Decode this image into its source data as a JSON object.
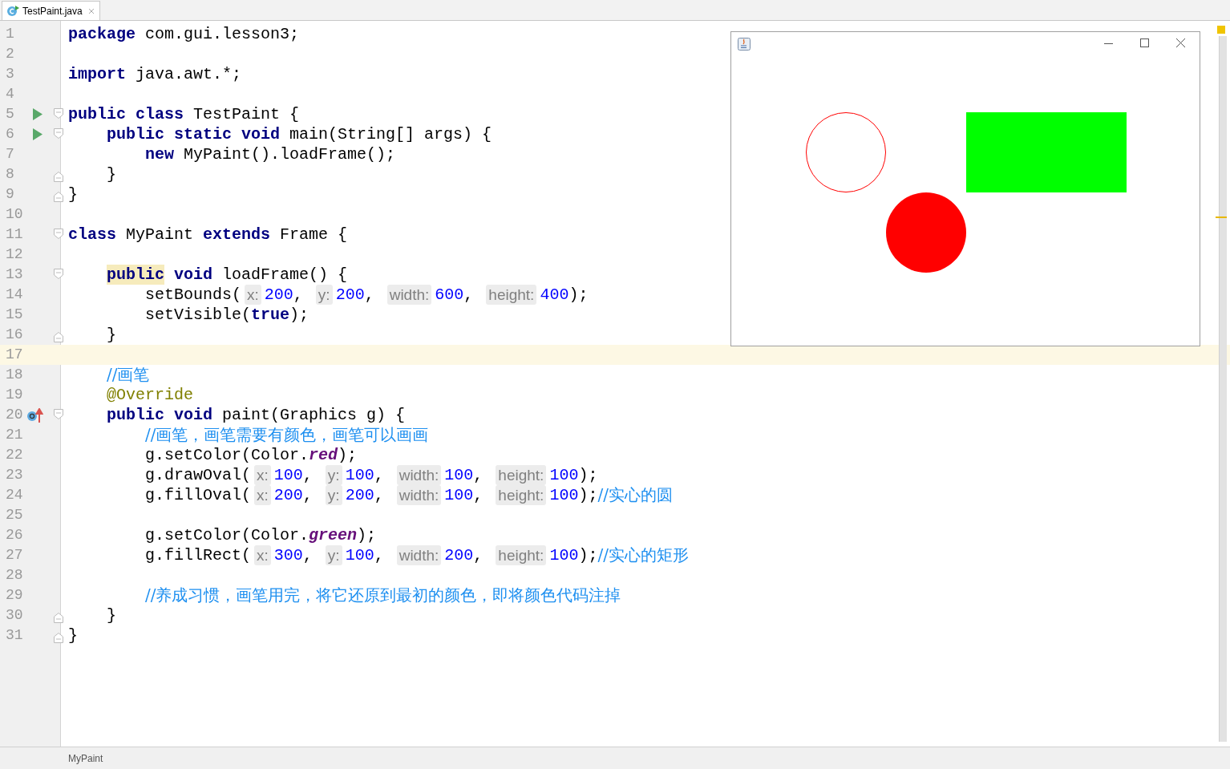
{
  "tabs": [
    {
      "label": "TestPaint.java",
      "selected": true
    }
  ],
  "editor": {
    "lines": [
      {
        "number": "1",
        "current": false,
        "run": false,
        "override": false,
        "fold_start": false,
        "fold_end": false,
        "tokens": [
          {
            "kind": "keyword",
            "text": "package"
          },
          {
            "kind": "plain",
            "text": " com.gui.lesson3;"
          }
        ]
      },
      {
        "number": "2",
        "current": false,
        "run": false,
        "override": false,
        "fold_start": false,
        "fold_end": false
      },
      {
        "number": "3",
        "current": false,
        "run": false,
        "override": false,
        "fold_start": false,
        "fold_end": false,
        "tokens": [
          {
            "kind": "keyword",
            "text": "import"
          },
          {
            "kind": "plain",
            "text": " java.awt.*;"
          }
        ]
      },
      {
        "number": "4",
        "current": false,
        "run": false,
        "override": false,
        "fold_start": false,
        "fold_end": false
      },
      {
        "number": "5",
        "current": false,
        "run": true,
        "override": false,
        "fold_start": true,
        "fold_end": false,
        "tokens": [
          {
            "kind": "keyword",
            "text": "public class"
          },
          {
            "kind": "plain",
            "text": " TestPaint {"
          }
        ]
      },
      {
        "number": "6",
        "current": false,
        "run": true,
        "override": false,
        "fold_start": true,
        "fold_end": false,
        "tokens": [
          {
            "kind": "keyword",
            "text": "    public static void"
          },
          {
            "kind": "plain",
            "text": " main(String[] args) {"
          }
        ]
      },
      {
        "number": "7",
        "current": false,
        "run": false,
        "override": false,
        "fold_start": false,
        "fold_end": false,
        "tokens": [
          {
            "kind": "keyword",
            "text": "        new"
          },
          {
            "kind": "plain",
            "text": " MyPaint().loadFrame();"
          }
        ]
      },
      {
        "number": "8",
        "current": false,
        "run": false,
        "override": false,
        "fold_start": false,
        "fold_end": true,
        "tokens": [
          {
            "kind": "plain",
            "text": "    }"
          }
        ]
      },
      {
        "number": "9",
        "current": false,
        "run": false,
        "override": false,
        "fold_start": false,
        "fold_end": true,
        "tokens": [
          {
            "kind": "plain",
            "text": "}"
          }
        ]
      },
      {
        "number": "10",
        "current": false,
        "run": false,
        "override": false,
        "fold_start": false,
        "fold_end": false
      },
      {
        "number": "11",
        "current": false,
        "run": false,
        "override": false,
        "fold_start": true,
        "fold_end": false,
        "tokens": [
          {
            "kind": "keyword",
            "text": "class"
          },
          {
            "kind": "plain",
            "text": " MyPaint "
          },
          {
            "kind": "keyword",
            "text": "extends"
          },
          {
            "kind": "plain",
            "text": " Frame {"
          }
        ]
      },
      {
        "number": "12",
        "current": false,
        "run": false,
        "override": false,
        "fold_start": false,
        "fold_end": false
      },
      {
        "number": "13",
        "current": false,
        "run": false,
        "override": false,
        "fold_start": true,
        "fold_end": false,
        "tokens": [
          {
            "kind": "keyword-marked",
            "text": "    public"
          },
          {
            "kind": "keyword",
            "text": " void"
          },
          {
            "kind": "plain",
            "text": " loadFrame() {"
          }
        ]
      },
      {
        "number": "14",
        "current": false,
        "run": false,
        "override": false,
        "fold_start": false,
        "fold_end": false,
        "tokens": [
          {
            "kind": "plain",
            "text": "        setBounds("
          },
          {
            "kind": "hint",
            "text": "x:"
          },
          {
            "kind": "number",
            "text": "200"
          },
          {
            "kind": "plain",
            "text": ", "
          },
          {
            "kind": "hint",
            "text": "y:"
          },
          {
            "kind": "number",
            "text": "200"
          },
          {
            "kind": "plain",
            "text": ", "
          },
          {
            "kind": "hint",
            "text": "width:"
          },
          {
            "kind": "number",
            "text": "600"
          },
          {
            "kind": "plain",
            "text": ", "
          },
          {
            "kind": "hint",
            "text": "height:"
          },
          {
            "kind": "number",
            "text": "400"
          },
          {
            "kind": "plain",
            "text": ");"
          }
        ]
      },
      {
        "number": "15",
        "current": false,
        "run": false,
        "override": false,
        "fold_start": false,
        "fold_end": false,
        "tokens": [
          {
            "kind": "plain",
            "text": "        setVisible("
          },
          {
            "kind": "keyword",
            "text": "true"
          },
          {
            "kind": "plain",
            "text": ");"
          }
        ]
      },
      {
        "number": "16",
        "current": false,
        "run": false,
        "override": false,
        "fold_start": false,
        "fold_end": true,
        "tokens": [
          {
            "kind": "plain",
            "text": "    }"
          }
        ]
      },
      {
        "number": "17",
        "current": true,
        "run": false,
        "override": false,
        "fold_start": false,
        "fold_end": false
      },
      {
        "number": "18",
        "current": false,
        "run": false,
        "override": false,
        "fold_start": false,
        "fold_end": false,
        "tokens": [
          {
            "kind": "comment",
            "text": "    //画笔"
          }
        ]
      },
      {
        "number": "19",
        "current": false,
        "run": false,
        "override": false,
        "fold_start": false,
        "fold_end": false,
        "tokens": [
          {
            "kind": "annotation",
            "text": "    @Override"
          }
        ]
      },
      {
        "number": "20",
        "current": false,
        "run": false,
        "override": true,
        "fold_start": true,
        "fold_end": false,
        "tokens": [
          {
            "kind": "keyword",
            "text": "    public void"
          },
          {
            "kind": "plain",
            "text": " paint(Graphics g) {"
          }
        ]
      },
      {
        "number": "21",
        "current": false,
        "run": false,
        "override": false,
        "fold_start": false,
        "fold_end": false,
        "tokens": [
          {
            "kind": "comment",
            "text": "        //画笔，画笔需要有颜色，画笔可以画画"
          }
        ]
      },
      {
        "number": "22",
        "current": false,
        "run": false,
        "override": false,
        "fold_start": false,
        "fold_end": false,
        "tokens": [
          {
            "kind": "plain",
            "text": "        g.setColor(Color."
          },
          {
            "kind": "field",
            "text": "red"
          },
          {
            "kind": "plain",
            "text": ");"
          }
        ]
      },
      {
        "number": "23",
        "current": false,
        "run": false,
        "override": false,
        "fold_start": false,
        "fold_end": false,
        "tokens": [
          {
            "kind": "plain",
            "text": "        g.drawOval("
          },
          {
            "kind": "hint",
            "text": "x:"
          },
          {
            "kind": "number",
            "text": "100"
          },
          {
            "kind": "plain",
            "text": ", "
          },
          {
            "kind": "hint",
            "text": "y:"
          },
          {
            "kind": "number",
            "text": "100"
          },
          {
            "kind": "plain",
            "text": ", "
          },
          {
            "kind": "hint",
            "text": "width:"
          },
          {
            "kind": "number",
            "text": "100"
          },
          {
            "kind": "plain",
            "text": ", "
          },
          {
            "kind": "hint",
            "text": "height:"
          },
          {
            "kind": "number",
            "text": "100"
          },
          {
            "kind": "plain",
            "text": ");"
          }
        ]
      },
      {
        "number": "24",
        "current": false,
        "run": false,
        "override": false,
        "fold_start": false,
        "fold_end": false,
        "tokens": [
          {
            "kind": "plain",
            "text": "        g.fillOval("
          },
          {
            "kind": "hint",
            "text": "x:"
          },
          {
            "kind": "number",
            "text": "200"
          },
          {
            "kind": "plain",
            "text": ", "
          },
          {
            "kind": "hint",
            "text": "y:"
          },
          {
            "kind": "number",
            "text": "200"
          },
          {
            "kind": "plain",
            "text": ", "
          },
          {
            "kind": "hint",
            "text": "width:"
          },
          {
            "kind": "number",
            "text": "100"
          },
          {
            "kind": "plain",
            "text": ", "
          },
          {
            "kind": "hint",
            "text": "height:"
          },
          {
            "kind": "number",
            "text": "100"
          },
          {
            "kind": "plain",
            "text": ");"
          },
          {
            "kind": "comment",
            "text": "//实心的圆"
          }
        ]
      },
      {
        "number": "25",
        "current": false,
        "run": false,
        "override": false,
        "fold_start": false,
        "fold_end": false
      },
      {
        "number": "26",
        "current": false,
        "run": false,
        "override": false,
        "fold_start": false,
        "fold_end": false,
        "tokens": [
          {
            "kind": "plain",
            "text": "        g.setColor(Color."
          },
          {
            "kind": "field",
            "text": "green"
          },
          {
            "kind": "plain",
            "text": ");"
          }
        ]
      },
      {
        "number": "27",
        "current": false,
        "run": false,
        "override": false,
        "fold_start": false,
        "fold_end": false,
        "tokens": [
          {
            "kind": "plain",
            "text": "        g.fillRect("
          },
          {
            "kind": "hint",
            "text": "x:"
          },
          {
            "kind": "number",
            "text": "300"
          },
          {
            "kind": "plain",
            "text": ", "
          },
          {
            "kind": "hint",
            "text": "y:"
          },
          {
            "kind": "number",
            "text": "100"
          },
          {
            "kind": "plain",
            "text": ", "
          },
          {
            "kind": "hint",
            "text": "width:"
          },
          {
            "kind": "number",
            "text": "200"
          },
          {
            "kind": "plain",
            "text": ", "
          },
          {
            "kind": "hint",
            "text": "height:"
          },
          {
            "kind": "number",
            "text": "100"
          },
          {
            "kind": "plain",
            "text": ");"
          },
          {
            "kind": "comment",
            "text": "//实心的矩形"
          }
        ]
      },
      {
        "number": "28",
        "current": false,
        "run": false,
        "override": false,
        "fold_start": false,
        "fold_end": false
      },
      {
        "number": "29",
        "current": false,
        "run": false,
        "override": false,
        "fold_start": false,
        "fold_end": false,
        "tokens": [
          {
            "kind": "comment",
            "text": "        //养成习惯，画笔用完，将它还原到最初的颜色，即将颜色代码注掉"
          }
        ]
      },
      {
        "number": "30",
        "current": false,
        "run": false,
        "override": false,
        "fold_start": false,
        "fold_end": true,
        "tokens": [
          {
            "kind": "plain",
            "text": "    }"
          }
        ]
      },
      {
        "number": "31",
        "current": false,
        "run": false,
        "override": false,
        "fold_start": false,
        "fold_end": true,
        "tokens": [
          {
            "kind": "plain",
            "text": "}"
          }
        ]
      }
    ]
  },
  "frame_window": {
    "shapes": [
      {
        "kind": "oval-outline",
        "color": "#ff0000"
      },
      {
        "kind": "oval-filled",
        "color": "#ff0000"
      },
      {
        "kind": "rect-filled",
        "color": "#00ff00"
      }
    ]
  },
  "status_bar": {
    "breadcrumb": "MyPaint"
  }
}
